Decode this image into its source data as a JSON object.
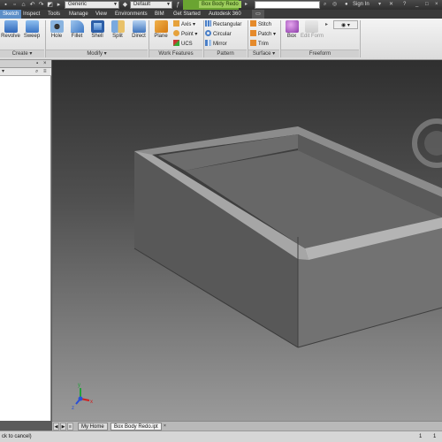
{
  "quick_access": {
    "appearance_value": "Generic",
    "material_value": "Default"
  },
  "title": {
    "document_name": "Box Body Redo"
  },
  "account": {
    "signin_label": "Sign In"
  },
  "menu": {
    "tabs": [
      "Sketch",
      "Inspect",
      "Tools",
      "Manage",
      "View",
      "Environments",
      "BIM",
      "Get Started",
      "Autodesk 360"
    ],
    "active_index": 0
  },
  "ribbon": {
    "create": {
      "revolve": "Revolve",
      "sweep": "Sweep",
      "panel": "Create"
    },
    "modify": {
      "hole": "Hole",
      "fillet": "Fillet",
      "shell": "Shell",
      "split": "Split",
      "direct": "Direct",
      "panel": "Modify"
    },
    "work_features": {
      "plane": "Plane",
      "axis": "Axis",
      "point": "Point",
      "ucs": "UCS",
      "panel": "Work Features"
    },
    "pattern": {
      "rectangular": "Rectangular",
      "circular": "Circular",
      "mirror": "Mirror",
      "panel": "Pattern"
    },
    "surface": {
      "stitch": "Stitch",
      "patch": "Patch",
      "trim": "Trim",
      "panel": "Surface"
    },
    "freeform": {
      "box": "Box",
      "edit_form": "Edit Form",
      "panel": "Freeform"
    }
  },
  "viewport": {
    "axis_labels": {
      "x": "x",
      "y": "y",
      "z": "z"
    },
    "colors": {
      "model_face_dark": "#4f4f4f",
      "model_face_mid": "#6e6e6e",
      "model_face_light": "#a9a9a9",
      "axis_x": "#d21f1f",
      "axis_y": "#23a23a",
      "axis_z": "#2a4fd6"
    }
  },
  "document_tabs": {
    "items": [
      "My Home",
      "Box Body Redo.ipt"
    ],
    "active_index": 1
  },
  "status": {
    "message": "ck to cancel)",
    "counts": [
      "1",
      "1"
    ]
  }
}
